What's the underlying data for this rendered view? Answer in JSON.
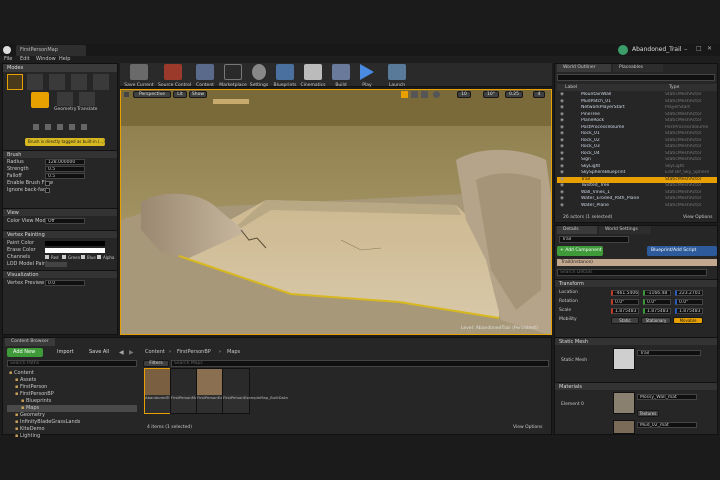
{
  "window": {
    "tab_title": "FirstPersonMap",
    "project_name": "Abandoned_Trail",
    "menu": [
      "File",
      "Edit",
      "Window",
      "Help"
    ]
  },
  "modes": {
    "title": "Modes",
    "tools": [
      "Geometry",
      "Translate"
    ],
    "hint": "Brush is directly tagged as built-in (...)",
    "brush_section": "Brush",
    "brush_props": [
      {
        "label": "Radius",
        "value": "128.000000"
      },
      {
        "label": "Strength",
        "value": "0.5"
      },
      {
        "label": "Falloff",
        "value": "0.5"
      },
      {
        "label": "Enable Brush Flow",
        "value": ""
      },
      {
        "label": "Ignore back-facin",
        "value": ""
      }
    ],
    "view_section": "View",
    "color_view_mode_label": "Color View Mode",
    "color_view_mode_value": "Off",
    "vertex_section": "Vertex Painting",
    "paint_color_label": "Paint Color",
    "erase_color_label": "Erase Color",
    "channels_label": "Channels",
    "channels": [
      "Red",
      "Green",
      "Blue",
      "Alpha"
    ],
    "lod_label": "LOD Model Paint",
    "visualization_section": "Visualization",
    "vertex_preview_label": "Vertex Preview S",
    "vertex_preview_value": "0.0"
  },
  "toolbar": {
    "buttons": [
      "Save Current",
      "Source Control",
      "Content",
      "Marketplace",
      "Settings",
      "Blueprints",
      "Cinematics",
      "Build",
      "Play",
      "Launch"
    ],
    "accent": "#e8a000"
  },
  "viewport": {
    "view_mode": "Perspective",
    "lit": "Lit",
    "show": "Show",
    "grid_snap": "10",
    "rot_snap": "10°",
    "scale_snap": "0.25",
    "cam_speed": "4",
    "overlay_text": "Level: AbandonedTrail (Persistent)",
    "banner_color": "#c8aa6e"
  },
  "outliner": {
    "tab_label": "World Outliner",
    "tab2_label": "Placeables",
    "col_label": "Label",
    "col_type": "Type",
    "items": [
      {
        "label": "MountainWall",
        "type": "StaticMeshActor"
      },
      {
        "label": "MudPatch_01",
        "type": "StaticMeshActor"
      },
      {
        "label": "NetworkPlayerStart",
        "type": "PlayerStart"
      },
      {
        "label": "PineTree",
        "type": "StaticMeshActor"
      },
      {
        "label": "PlaneRock",
        "type": "StaticMeshActor"
      },
      {
        "label": "PostProcessVolume",
        "type": "PostProcessVolume"
      },
      {
        "label": "Rock_01",
        "type": "StaticMeshActor"
      },
      {
        "label": "Rock_02",
        "type": "StaticMeshActor"
      },
      {
        "label": "Rock_03",
        "type": "StaticMeshActor"
      },
      {
        "label": "Rock_04",
        "type": "StaticMeshActor"
      },
      {
        "label": "Sign",
        "type": "StaticMeshActor"
      },
      {
        "label": "SkyLight",
        "type": "SkyLight"
      },
      {
        "label": "SkySphereBlueprint",
        "type": "Edit BP_Sky_Sphere"
      },
      {
        "label": "Trail",
        "type": "StaticMeshActor"
      },
      {
        "label": "Twisted_Tree",
        "type": "StaticMeshActor"
      },
      {
        "label": "Wall_Vines_1",
        "type": "StaticMeshActor"
      },
      {
        "label": "Water_Eroded_Path_Plane",
        "type": "StaticMeshActor"
      },
      {
        "label": "Water_Plane",
        "type": "StaticMeshActor"
      }
    ],
    "selected_index": 13,
    "footer": "26 actors (1 selected)",
    "view_options": "View Options"
  },
  "details": {
    "tab_label": "Details",
    "tab2_label": "World Settings",
    "actor_name": "Trail",
    "add_component": "+ Add Component",
    "blueprint_button": "Blueprint/Add Script",
    "instance_row": "Trail(Instance)",
    "search_placeholder": "Search Details",
    "transform_section": "Transform",
    "location_label": "Location",
    "location": [
      "-461.5406",
      "-1166.48",
      "223.2701"
    ],
    "rotation_label": "Rotation",
    "rotation": [
      "0.0°",
      "0.0°",
      "0.0°"
    ],
    "scale_label": "Scale",
    "scale": [
      "1.875483",
      "1.875483",
      "1.875483"
    ],
    "mobility_label": "Mobility",
    "mobility": [
      "Static",
      "Stationary",
      "Movable"
    ],
    "static_mesh_section": "Static Mesh",
    "static_mesh_label": "Static Mesh",
    "static_mesh_value": "Trail",
    "materials_section": "Materials",
    "element0_label": "Element 0",
    "element0_value": "Mossy_Wall_mat",
    "element0_sub": "Textures",
    "element1_value": "Mud_02_mat"
  },
  "content_browser": {
    "tab_label": "Content Browser",
    "add_new": "Add New",
    "import": "Import",
    "save_all": "Save All",
    "path": [
      "Content",
      "FirstPersonBP",
      "Maps"
    ],
    "search_placeholder": "Search Paths",
    "tree": [
      "Content",
      "Assets",
      "FirstPerson",
      "FirstPersonBP",
      "Blueprints",
      "Maps",
      "Geometry",
      "InfinityBladeGrassLands",
      "KiteDemo",
      "Lighting"
    ],
    "filters": "Filters",
    "asset_search_placeholder": "Search Maps",
    "assets": [
      "AbandonedTrail",
      "FirstPersonMap_BuiltData",
      "FirstPersonExampleMap",
      "FirstPersonExampleMap_BuiltData"
    ],
    "footer": "4 items (1 selected)",
    "view_options": "View Options"
  }
}
